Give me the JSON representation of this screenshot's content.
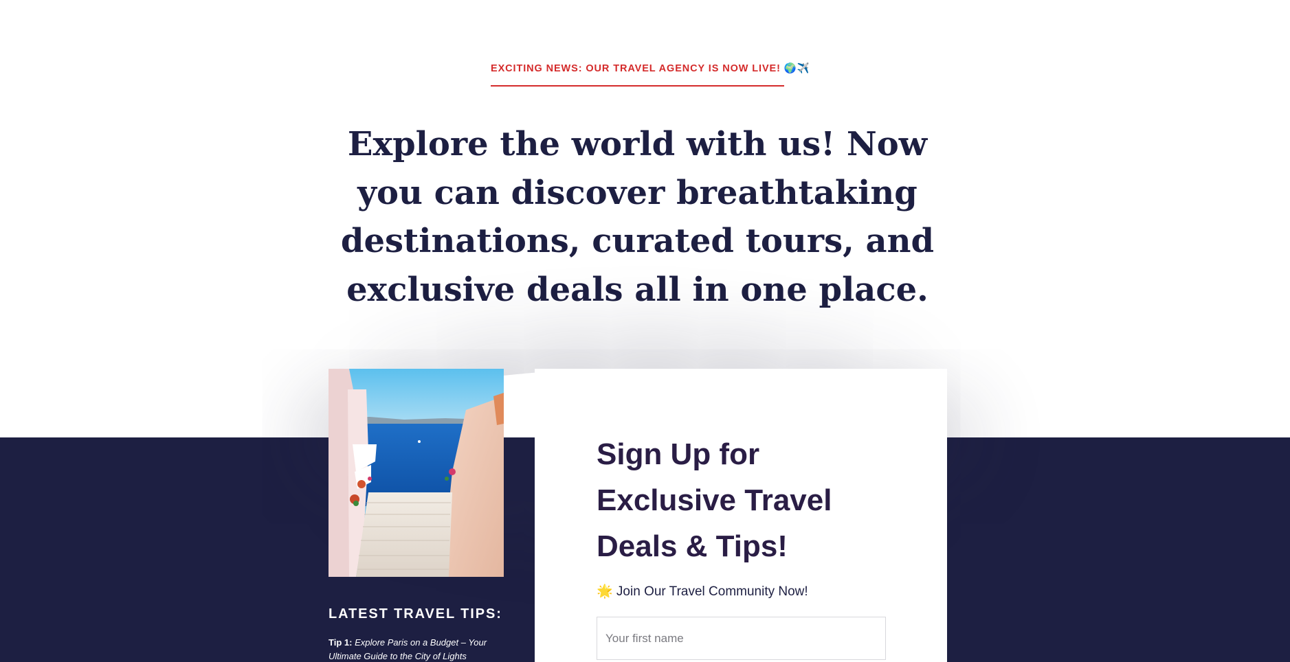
{
  "announcement": {
    "text": "EXCITING NEWS: OUR TRAVEL AGENCY IS NOW LIVE! 🌍✈️"
  },
  "hero": {
    "title": "Explore the world with us! Now you can discover breathtaking destinations, curated tours, and exclusive deals all in one place."
  },
  "tips": {
    "heading": "LATEST TRAVEL TIPS:",
    "items": [
      {
        "label": "Tip 1:",
        "text": "Explore Paris on a Budget – Your Ultimate Guide to the City of Lights"
      }
    ]
  },
  "signup": {
    "title": "Sign Up for Exclusive Travel Deals & Tips!",
    "community": "🌟 Join Our Travel Community Now!",
    "first_name_placeholder": "Your first name"
  },
  "colors": {
    "navy": "#1d1f42",
    "accent_red": "#d42a2a",
    "heading_purple": "#2a1d45"
  },
  "icons": {
    "photo": "santorini-stairs-photo"
  }
}
